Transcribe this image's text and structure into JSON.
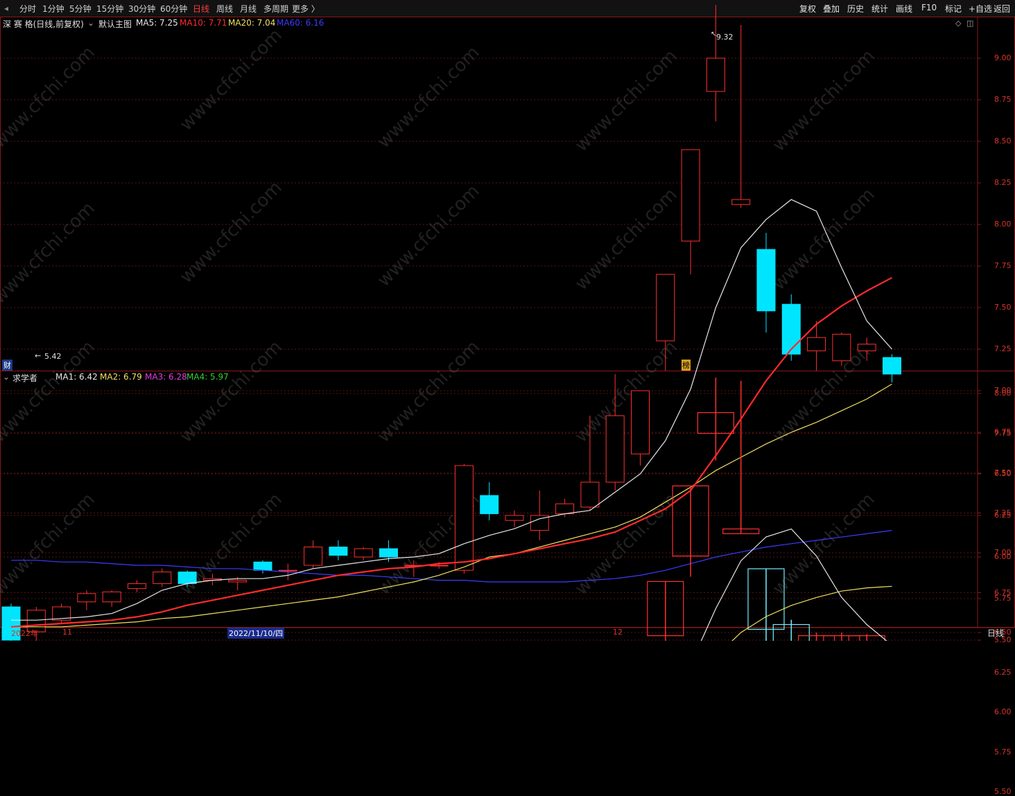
{
  "toolbar": {
    "tabs": [
      "分时",
      "1分钟",
      "5分钟",
      "15分钟",
      "30分钟",
      "60分钟",
      "日线",
      "周线",
      "月线",
      "多周期",
      "更多 〉"
    ],
    "active_tab": "日线",
    "right_buttons": [
      "复权",
      "叠加",
      "历史",
      "统计",
      "画线",
      "F10",
      "标记",
      "+自选",
      "返回"
    ]
  },
  "main_chart": {
    "title": "深 赛 格(日线,前复权)",
    "template": "默认主图",
    "ma_items": [
      {
        "label": "MA5: 7.25",
        "color": "#e8e8e8"
      },
      {
        "label": "MA10: 7.71",
        "color": "#ff2b2b"
      },
      {
        "label": "MA20: 7.04",
        "color": "#f0e060"
      },
      {
        "label": "MA60: 6.16",
        "color": "#3c3cff"
      }
    ],
    "high_label": "9.32",
    "low_label": "5.42",
    "fin_badge": "财",
    "rank_badge": "榜",
    "price_axis": [
      "9.00",
      "8.75",
      "8.50",
      "8.25",
      "8.00",
      "7.75",
      "7.50",
      "7.25",
      "7.00",
      "6.75",
      "6.50",
      "6.25",
      "6.00",
      "5.75",
      "5.50"
    ]
  },
  "sub_chart": {
    "title": "求学者",
    "ma_items": [
      {
        "label": "MA1: 6.42",
        "color": "#e8e8e8"
      },
      {
        "label": "MA2: 6.79",
        "color": "#f0e060"
      },
      {
        "label": "MA3: 6.28",
        "color": "#e040e0"
      },
      {
        "label": "MA4: 5.97",
        "color": "#30d030"
      }
    ],
    "price_axis": [
      "8.00",
      "7.75",
      "7.50",
      "7.25",
      "7.00",
      "6.75",
      "6.50",
      "6.25",
      "6.00",
      "5.75",
      "5.50"
    ]
  },
  "date_axis": {
    "labels": [
      "2022年",
      "11",
      "2022/11/10/四",
      "12"
    ],
    "period": "日线"
  },
  "watermark": "www.cfchi.com",
  "candles": [
    {
      "o": 5.7,
      "c": 5.5,
      "h": 5.72,
      "l": 5.48
    },
    {
      "o": 5.55,
      "c": 5.68,
      "h": 5.7,
      "l": 5.42
    },
    {
      "o": 5.62,
      "c": 5.7,
      "h": 5.72,
      "l": 5.6
    },
    {
      "o": 5.73,
      "c": 5.78,
      "h": 5.8,
      "l": 5.68
    },
    {
      "o": 5.73,
      "c": 5.79,
      "h": 5.8,
      "l": 5.7
    },
    {
      "o": 5.81,
      "c": 5.84,
      "h": 5.86,
      "l": 5.79
    },
    {
      "o": 5.84,
      "c": 5.91,
      "h": 5.93,
      "l": 5.82
    },
    {
      "o": 5.91,
      "c": 5.84,
      "h": 5.92,
      "l": 5.82
    },
    {
      "o": 5.86,
      "c": 5.87,
      "h": 5.9,
      "l": 5.83
    },
    {
      "o": 5.85,
      "c": 5.86,
      "h": 5.88,
      "l": 5.8
    },
    {
      "o": 5.97,
      "c": 5.92,
      "h": 5.98,
      "l": 5.9
    },
    {
      "o": 5.92,
      "c": 5.92,
      "h": 5.96,
      "l": 5.86
    },
    {
      "o": 5.95,
      "c": 6.06,
      "h": 6.1,
      "l": 5.93
    },
    {
      "o": 6.06,
      "c": 6.01,
      "h": 6.1,
      "l": 5.98
    },
    {
      "o": 6.0,
      "c": 6.05,
      "h": 6.06,
      "l": 5.98
    },
    {
      "o": 6.05,
      "c": 6.0,
      "h": 6.1,
      "l": 5.97
    },
    {
      "o": 5.95,
      "c": 5.95,
      "h": 5.98,
      "l": 5.88
    },
    {
      "o": 5.95,
      "c": 5.95,
      "h": 5.97,
      "l": 5.93
    },
    {
      "o": 5.92,
      "c": 6.55,
      "h": 6.56,
      "l": 5.9
    },
    {
      "o": 6.37,
      "c": 6.26,
      "h": 6.45,
      "l": 6.22
    },
    {
      "o": 6.22,
      "c": 6.25,
      "h": 6.28,
      "l": 6.18
    },
    {
      "o": 6.16,
      "c": 6.25,
      "h": 6.4,
      "l": 6.1
    },
    {
      "o": 6.26,
      "c": 6.32,
      "h": 6.35,
      "l": 6.24
    },
    {
      "o": 6.3,
      "c": 6.45,
      "h": 6.85,
      "l": 6.28
    },
    {
      "o": 6.45,
      "c": 6.85,
      "h": 7.1,
      "l": 6.4
    },
    {
      "o": 6.62,
      "c": 7.0,
      "h": 7.0,
      "l": 6.55
    },
    {
      "o": 7.3,
      "c": 7.7,
      "h": 7.7,
      "l": 7.12
    },
    {
      "o": 7.9,
      "c": 8.45,
      "h": 8.45,
      "l": 7.7
    },
    {
      "o": 8.8,
      "c": 9.0,
      "h": 9.32,
      "l": 8.62
    },
    {
      "o": 8.12,
      "c": 8.15,
      "h": 9.2,
      "l": 8.1
    },
    {
      "o": 7.85,
      "c": 7.48,
      "h": 7.95,
      "l": 7.35
    },
    {
      "o": 7.52,
      "c": 7.22,
      "h": 7.58,
      "l": 7.18
    },
    {
      "o": 7.24,
      "c": 7.32,
      "h": 7.42,
      "l": 7.12
    },
    {
      "o": 7.18,
      "c": 7.34,
      "h": 7.35,
      "l": 7.15
    },
    {
      "o": 7.24,
      "c": 7.28,
      "h": 7.32,
      "l": 7.18
    },
    {
      "o": 7.2,
      "c": 7.1,
      "h": 7.22,
      "l": 7.05
    }
  ],
  "ma_series": {
    "ma5": [
      5.62,
      5.62,
      5.63,
      5.64,
      5.66,
      5.72,
      5.8,
      5.84,
      5.86,
      5.87,
      5.87,
      5.89,
      5.93,
      5.95,
      5.97,
      5.99,
      6.0,
      6.02,
      6.08,
      6.13,
      6.17,
      6.23,
      6.26,
      6.28,
      6.39,
      6.5,
      6.7,
      7.01,
      7.5,
      7.86,
      8.03,
      8.15,
      8.08,
      7.74,
      7.42,
      7.25
    ],
    "ma10": [
      5.58,
      5.59,
      5.6,
      5.61,
      5.62,
      5.64,
      5.67,
      5.71,
      5.74,
      5.77,
      5.8,
      5.83,
      5.86,
      5.89,
      5.91,
      5.93,
      5.94,
      5.96,
      5.97,
      5.99,
      6.02,
      6.05,
      6.08,
      6.11,
      6.15,
      6.22,
      6.29,
      6.4,
      6.61,
      6.83,
      7.06,
      7.25,
      7.4,
      7.51,
      7.6,
      7.68,
      7.71,
      7.71
    ],
    "ma20": [
      5.58,
      5.58,
      5.58,
      5.59,
      5.6,
      5.61,
      5.63,
      5.64,
      5.66,
      5.68,
      5.7,
      5.72,
      5.74,
      5.76,
      5.79,
      5.82,
      5.85,
      5.89,
      5.94,
      6.0,
      6.02,
      6.06,
      6.1,
      6.14,
      6.18,
      6.24,
      6.33,
      6.42,
      6.52,
      6.6,
      6.68,
      6.75,
      6.81,
      6.88,
      6.95,
      7.04
    ],
    "ma60": [
      5.98,
      5.98,
      5.97,
      5.97,
      5.96,
      5.95,
      5.95,
      5.94,
      5.93,
      5.93,
      5.92,
      5.91,
      5.9,
      5.89,
      5.89,
      5.88,
      5.87,
      5.86,
      5.86,
      5.85,
      5.85,
      5.85,
      5.85,
      5.86,
      5.87,
      5.89,
      5.92,
      5.96,
      6.0,
      6.03,
      6.06,
      6.08,
      6.1,
      6.12,
      6.14,
      6.16
    ]
  },
  "sub_candles": [
    {
      "o": 5.38,
      "c": 5.48,
      "h": 5.5,
      "l": 5.35
    },
    {
      "o": 5.55,
      "c": 5.42,
      "h": 5.56,
      "l": 5.4
    },
    {
      "o": 5.48,
      "c": 5.55,
      "h": 5.57,
      "l": 5.45
    },
    {
      "o": 5.47,
      "c": 5.55,
      "h": 5.57,
      "l": 5.45
    },
    {
      "o": 5.48,
      "c": 5.52,
      "h": 5.54,
      "l": 5.46
    },
    {
      "o": 5.38,
      "c": 5.52,
      "h": 5.53,
      "l": 5.36
    },
    {
      "o": 5.52,
      "c": 5.4,
      "h": 5.54,
      "l": 5.38
    },
    {
      "o": 5.44,
      "c": 5.46,
      "h": 5.48,
      "l": 5.4
    },
    {
      "o": 5.48,
      "c": 5.44,
      "h": 5.5,
      "l": 5.42
    },
    {
      "o": 5.51,
      "c": 5.55,
      "h": 5.57,
      "l": 5.49
    },
    {
      "o": 5.5,
      "c": 5.48,
      "h": 5.52,
      "l": 5.46
    },
    {
      "o": 5.47,
      "c": 5.5,
      "h": 5.52,
      "l": 5.45
    },
    {
      "o": 5.52,
      "c": 5.49,
      "h": 5.56,
      "l": 5.47
    },
    {
      "o": 5.5,
      "c": 5.55,
      "h": 5.56,
      "l": 5.48
    },
    {
      "o": 5.52,
      "c": 5.54,
      "h": 5.58,
      "l": 5.5
    },
    {
      "o": 5.55,
      "c": 5.52,
      "h": 5.56,
      "l": 5.49
    },
    {
      "o": 5.52,
      "c": 5.55,
      "h": 5.57,
      "l": 5.5
    },
    {
      "o": 5.52,
      "c": 5.58,
      "h": 5.58,
      "l": 5.5
    },
    {
      "o": 5.55,
      "c": 5.96,
      "h": 5.96,
      "l": 5.55
    },
    {
      "o": 5.82,
      "c": 5.72,
      "h": 5.85,
      "l": 5.7
    },
    {
      "o": 5.72,
      "c": 5.75,
      "h": 5.78,
      "l": 5.7
    },
    {
      "o": 5.74,
      "c": 5.8,
      "h": 5.95,
      "l": 5.7
    },
    {
      "o": 5.8,
      "c": 5.72,
      "h": 5.82,
      "l": 5.7
    },
    {
      "o": 5.76,
      "c": 5.82,
      "h": 6.1,
      "l": 5.64
    },
    {
      "o": 5.7,
      "c": 6.08,
      "h": 6.25,
      "l": 5.68
    },
    {
      "o": 5.9,
      "c": 6.22,
      "h": 6.25,
      "l": 5.85
    },
    {
      "o": 6.48,
      "c": 6.82,
      "h": 6.82,
      "l": 6.4
    },
    {
      "o": 6.98,
      "c": 7.42,
      "h": 7.42,
      "l": 6.85
    },
    {
      "o": 7.75,
      "c": 7.88,
      "h": 8.1,
      "l": 7.58
    },
    {
      "o": 7.12,
      "c": 7.15,
      "h": 8.08,
      "l": 7.12
    },
    {
      "o": 6.9,
      "c": 6.52,
      "h": 6.9,
      "l": 6.4
    },
    {
      "o": 6.55,
      "c": 6.32,
      "h": 6.58,
      "l": 6.28
    },
    {
      "o": 6.36,
      "c": 6.48,
      "h": 6.5,
      "l": 6.32
    },
    {
      "o": 6.36,
      "c": 6.48,
      "h": 6.5,
      "l": 6.33
    },
    {
      "o": 6.4,
      "c": 6.48,
      "h": 6.49,
      "l": 6.36
    },
    {
      "o": 6.38,
      "c": 6.32,
      "h": 6.4,
      "l": 6.28
    }
  ],
  "sub_ma_series": {
    "ma1": [
      5.4,
      5.41,
      5.42,
      5.43,
      5.44,
      5.45,
      5.46,
      5.47,
      5.47,
      5.48,
      5.48,
      5.49,
      5.49,
      5.5,
      5.5,
      5.51,
      5.51,
      5.53,
      5.58,
      5.62,
      5.66,
      5.7,
      5.72,
      5.74,
      5.8,
      5.88,
      6.05,
      6.3,
      6.65,
      6.95,
      7.1,
      7.15,
      6.98,
      6.72,
      6.55,
      6.42
    ],
    "ma2": [
      5.36,
      5.37,
      5.38,
      5.39,
      5.4,
      5.41,
      5.41,
      5.42,
      5.43,
      5.44,
      5.45,
      5.46,
      5.46,
      5.47,
      5.47,
      5.48,
      5.49,
      5.5,
      5.51,
      5.53,
      5.56,
      5.59,
      5.62,
      5.65,
      5.7,
      5.76,
      5.9,
      6.08,
      6.35,
      6.5,
      6.6,
      6.67,
      6.72,
      6.76,
      6.78,
      6.79
    ],
    "ma3": [
      5.32,
      5.33,
      5.34,
      5.35,
      5.36,
      5.37,
      5.38,
      5.39,
      5.4,
      5.41,
      5.42,
      5.42,
      5.43,
      5.44,
      5.45,
      5.46,
      5.47,
      5.48,
      5.5,
      5.52,
      5.54,
      5.56,
      5.58,
      5.6,
      5.64,
      5.69,
      5.76,
      5.86,
      5.95,
      6.0,
      6.05,
      6.1,
      6.15,
      6.2,
      6.24,
      6.28
    ],
    "ma4": [
      5.29,
      5.3,
      5.3,
      5.31,
      5.31,
      5.32,
      5.33,
      5.33,
      5.34,
      5.35,
      5.35,
      5.36,
      5.37,
      5.37,
      5.38,
      5.39,
      5.4,
      5.4,
      5.42,
      5.44,
      5.46,
      5.48,
      5.5,
      5.52,
      5.55,
      5.58,
      5.63,
      5.7,
      5.75,
      5.78,
      5.8,
      5.83,
      5.86,
      5.89,
      5.93,
      5.97
    ]
  }
}
